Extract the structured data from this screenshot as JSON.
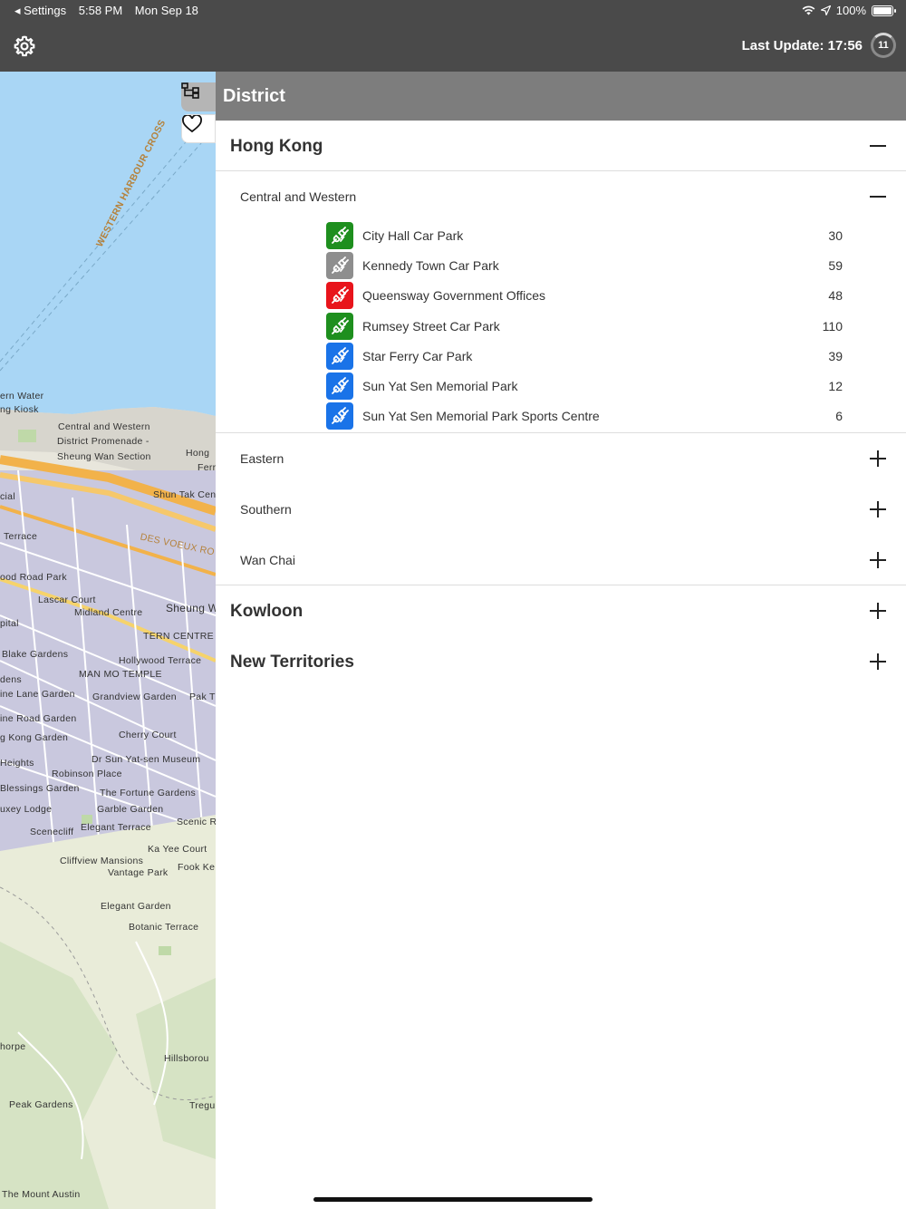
{
  "status_bar": {
    "back_label": "◂ Settings",
    "time": "5:58 PM",
    "date": "Mon Sep 18",
    "battery": "100%"
  },
  "toolbar": {
    "last_update": "Last Update: 17:56",
    "refresh_count": "11"
  },
  "map": {
    "labels": [
      "WESTERN HARBOUR CROSS",
      "ern Water",
      "ng Kiosk",
      "Central and Western",
      "District Promenade -",
      "Sheung Wan Section",
      "Hong",
      "Ferr",
      "Shun Tak Cen",
      "cial",
      "Terrace",
      "DES VOEUX RO",
      "ood Road Park",
      "Lascar Court",
      "Midland Centre",
      "Sheung W",
      "pital",
      "TERN CENTRE",
      "Blake Gardens",
      "Hollywood Terrace",
      "MAN MO TEMPLE",
      "dens",
      "ine Lane Garden",
      "Grandview Garden",
      "Pak T",
      "ine Road Garden",
      "Cherry Court",
      "g Kong Garden",
      "Dr Sun Yat-sen Museum",
      "Heights",
      "Robinson Place",
      "Blessings Garden",
      "The Fortune Gardens",
      "uxey Lodge",
      "Garble Garden",
      "Scenecliff",
      "Elegant Terrace",
      "Scenic R",
      "Ka Yee Court",
      "Cliffview Mansions",
      "Fook Ke",
      "Vantage Park",
      "Elegant Garden",
      "Botanic Terrace",
      "horpe",
      "Hillsborou",
      "Peak Gardens",
      "Tregu",
      "The Mount Austin"
    ]
  },
  "panel": {
    "title": "District",
    "regions": [
      {
        "name": "Hong Kong",
        "expanded": true,
        "districts": [
          {
            "name": "Central and Western",
            "expanded": true,
            "carparks": [
              {
                "name": "City Hall Car Park",
                "count": "30",
                "color": "#1e8f1e"
              },
              {
                "name": "Kennedy Town Car Park",
                "count": "59",
                "color": "#8e8e8e"
              },
              {
                "name": "Queensway Government Offices",
                "count": "48",
                "color": "#e8141b"
              },
              {
                "name": "Rumsey Street Car Park",
                "count": "110",
                "color": "#1e8f1e"
              },
              {
                "name": "Star Ferry Car Park",
                "count": "39",
                "color": "#1a73e8"
              },
              {
                "name": "Sun Yat Sen Memorial Park",
                "count": "12",
                "color": "#1a73e8"
              },
              {
                "name": "Sun Yat Sen Memorial Park Sports Centre",
                "count": "6",
                "color": "#1a73e8"
              }
            ]
          },
          {
            "name": "Eastern",
            "expanded": false
          },
          {
            "name": "Southern",
            "expanded": false
          },
          {
            "name": "Wan Chai",
            "expanded": false
          }
        ]
      },
      {
        "name": "Kowloon",
        "expanded": false
      },
      {
        "name": "New Territories",
        "expanded": false
      }
    ]
  },
  "icons": {
    "settings": "gear-icon",
    "refresh": "refresh-icon",
    "tree": "tree-icon",
    "favorite": "heart-icon",
    "charger": "ev-plug-icon"
  }
}
